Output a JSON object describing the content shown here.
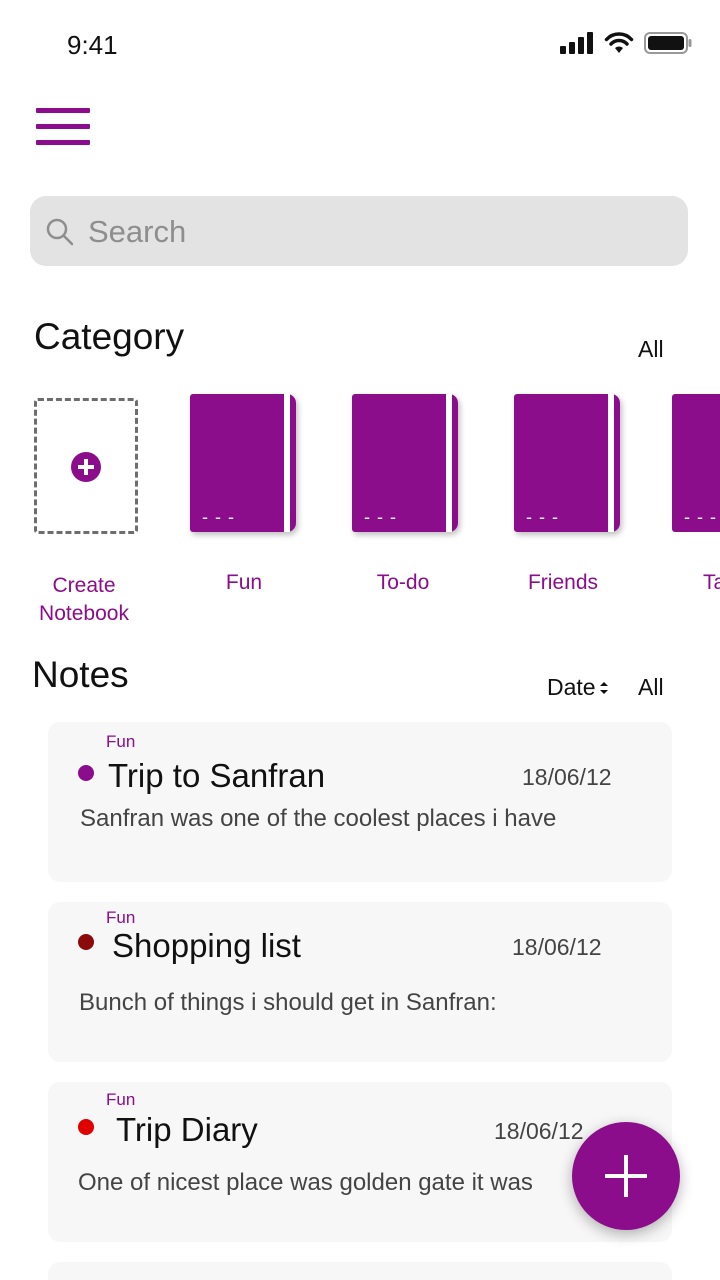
{
  "status_bar": {
    "time": "9:41",
    "icons": [
      "signal-icon",
      "wifi-icon",
      "battery-icon"
    ]
  },
  "header": {
    "menu_icon": "hamburger-menu-icon"
  },
  "search": {
    "placeholder": "Search",
    "value": ""
  },
  "category": {
    "title": "Category",
    "all_label": "All",
    "create_label_line1": "Create",
    "create_label_line2": "Notebook",
    "notebooks": [
      {
        "label": "Fun"
      },
      {
        "label": "To-do"
      },
      {
        "label": "Friends"
      },
      {
        "label": "Ta"
      }
    ]
  },
  "notes": {
    "title": "Notes",
    "sort_label": "Date",
    "all_label": "All",
    "items": [
      {
        "category": "Fun",
        "title": "Trip to Sanfran",
        "date": "18/06/12",
        "snippet": "Sanfran was one of the coolest places i have",
        "dot_color": "#8b0d8b"
      },
      {
        "category": "Fun",
        "title": "Shopping list",
        "date": "18/06/12",
        "snippet": "Bunch of things i should get in Sanfran:",
        "dot_color": "#8b0b0b"
      },
      {
        "category": "Fun",
        "title": "Trip Diary",
        "date": "18/06/12",
        "snippet": "One of nicest place was golden gate it was",
        "dot_color": "#e00000"
      }
    ]
  },
  "fab": {
    "icon": "plus-icon"
  },
  "colors": {
    "accent": "#8b0d8b",
    "card_background": "#f7f7f7",
    "search_background": "#e3e3e3"
  }
}
